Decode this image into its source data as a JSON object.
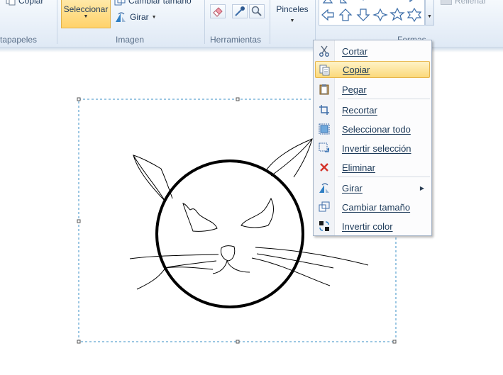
{
  "ribbon": {
    "copy_label": "Copiar",
    "select_label": "Seleccionar",
    "resize_label": "Cambiar tamaño",
    "rotate_label": "Girar",
    "brushes_label": "Pinceles",
    "fill_label": "Rellenar",
    "groups": {
      "clipboard": "tapapeles",
      "image": "Imagen",
      "tools": "Herramientas",
      "shapes": "Formas"
    }
  },
  "context_menu": {
    "items": [
      {
        "label": "Cortar",
        "icon": "scissors-icon"
      },
      {
        "label": "Copiar",
        "icon": "copy-icon",
        "highlighted": true
      },
      {
        "label": "Pegar",
        "icon": "paste-icon"
      },
      {
        "label": "Recortar",
        "icon": "crop-icon"
      },
      {
        "label": "Seleccionar todo",
        "icon": "select-all-icon"
      },
      {
        "label": "Invertir selección",
        "icon": "invert-selection-icon"
      },
      {
        "label": "Eliminar",
        "icon": "delete-icon"
      },
      {
        "label": "Girar",
        "icon": "rotate-icon",
        "submenu": true
      },
      {
        "label": "Cambiar tamaño",
        "icon": "resize-icon"
      },
      {
        "label": "Invertir color",
        "icon": "invert-color-icon"
      }
    ]
  },
  "colors": {
    "menu_highlight": "#fbd97a",
    "selection_border": "#3a8fc7",
    "ribbon_bg": "#dfe9f5"
  }
}
